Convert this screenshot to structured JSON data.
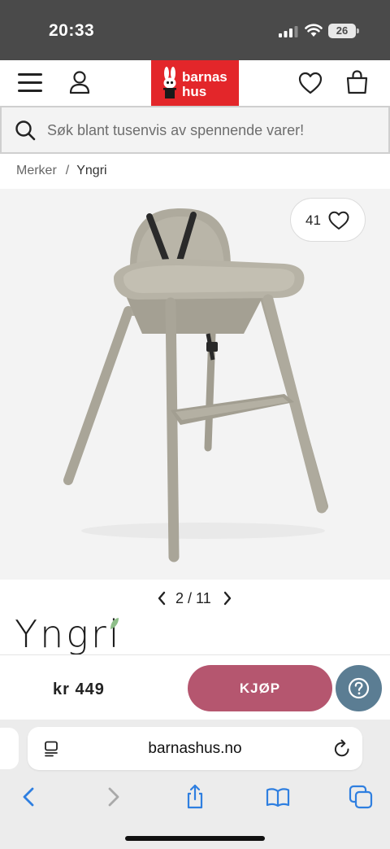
{
  "status_bar": {
    "time": "20:33",
    "battery": "26"
  },
  "header": {
    "logo_line1": "barnas",
    "logo_line2": "hus",
    "brand_color": "#e3262a"
  },
  "search": {
    "placeholder": "Søk blant tusenvis av spennende varer!"
  },
  "breadcrumb": {
    "items": [
      "Merker",
      "Yngri"
    ],
    "separator": "/"
  },
  "gallery": {
    "favorites_count": "41",
    "current": "2",
    "total": "11",
    "pager_label": "2 / 11"
  },
  "product": {
    "brand": "Yngri"
  },
  "purchase": {
    "price": "kr 449",
    "buy_label": "KJØP",
    "buy_color": "#b5566f",
    "help_color": "#5b7d93"
  },
  "browser": {
    "url": "barnashus.no"
  },
  "icons": {
    "menu": "hamburger-icon",
    "account": "user-icon",
    "wishlist": "heart-icon",
    "cart": "shopping-bag-icon",
    "search": "search-icon",
    "help": "question-icon",
    "reader": "reader-icon",
    "reload": "reload-icon",
    "back": "chevron-left-icon",
    "forward": "chevron-right-icon",
    "share": "share-icon",
    "bookmarks": "book-icon",
    "tabs": "tabs-icon"
  }
}
